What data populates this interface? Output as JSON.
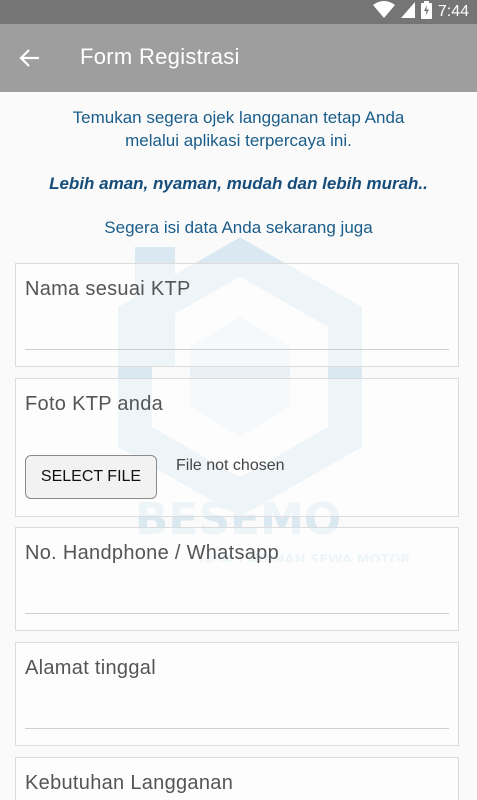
{
  "status_bar": {
    "time": "7:44"
  },
  "app_bar": {
    "title": "Form Registrasi"
  },
  "intro": {
    "line1": "Temukan segera ojek langganan tetap Anda",
    "line2": "melalui aplikasi terpercaya ini.",
    "tagline": "Lebih aman, nyaman, mudah  dan lebih murah..",
    "call_to_action": "Segera isi data Anda sekarang juga"
  },
  "form": {
    "name_label": "Nama sesuai KTP",
    "ktp_label": "Foto KTP anda",
    "select_file_label": "SELECT FILE",
    "file_status": "File not chosen",
    "phone_label": "No. Handphone / Whatsapp",
    "address_label": "Alamat tinggal",
    "needs_label": "Kebutuhan Langganan"
  },
  "watermark": {
    "brand": "BESEMO",
    "tagline": "JASA LAYANAN SEWA MOTOR"
  },
  "colors": {
    "status_bar": "#757575",
    "app_bar": "#9e9e9e",
    "intro_text": "#1a5d8a",
    "watermark": "#3a8fcf"
  }
}
